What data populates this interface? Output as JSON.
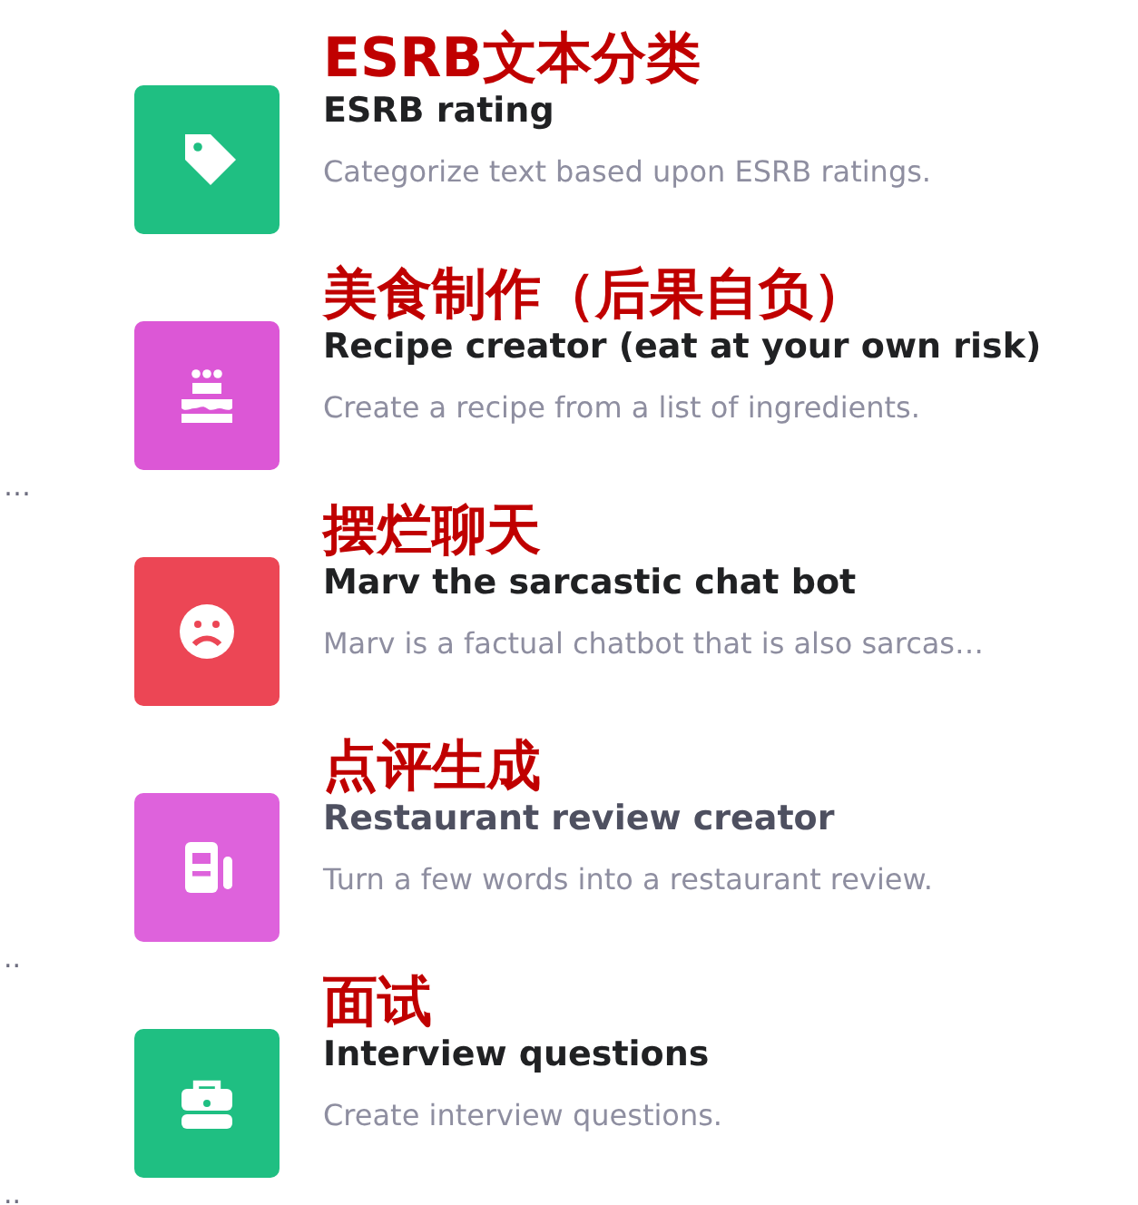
{
  "items": [
    {
      "kind": "tag",
      "color": "#1fbf82",
      "annotation": "ESRB文本分类",
      "title": "ESRB rating",
      "description": "Categorize text based upon ESRB ratings.",
      "dimmed": false
    },
    {
      "kind": "cake",
      "color": "#dc57d6",
      "annotation": "美食制作（后果自负）",
      "title": "Recipe creator (eat at your own risk)",
      "description": "Create a recipe from a list of ingredients.",
      "dimmed": false,
      "left_fragment": "…"
    },
    {
      "kind": "frown",
      "color": "#ec4655",
      "annotation": "摆烂聊天",
      "title": "Marv the sarcastic chat bot",
      "description": "Marv is a factual chatbot that is also sarcas…",
      "dimmed": false
    },
    {
      "kind": "news",
      "color": "#de62dc",
      "annotation": "点评生成",
      "title": "Restaurant review creator",
      "description": "Turn a few words into a restaurant review.",
      "dimmed": true,
      "left_fragment": ".."
    },
    {
      "kind": "briefcase",
      "color": "#1fbf82",
      "annotation": "面试",
      "title": "Interview questions",
      "description": "Create interview questions.",
      "dimmed": false,
      "left_fragment": ".."
    }
  ]
}
